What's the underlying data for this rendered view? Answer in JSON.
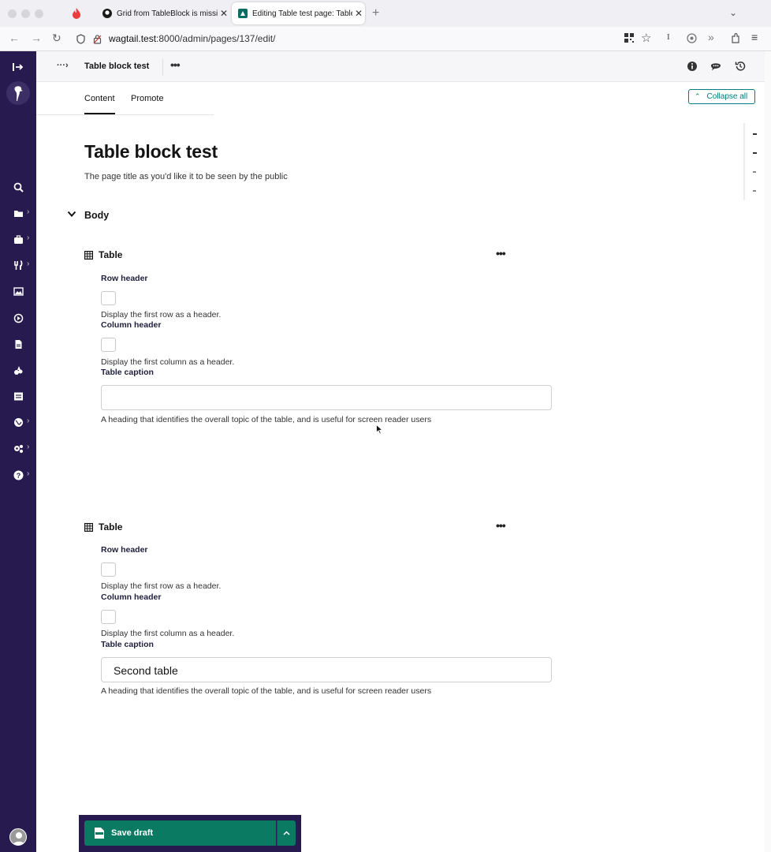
{
  "browser": {
    "tabs": [
      {
        "label": "Grid from TableBlock is missing",
        "active": false
      },
      {
        "label": "Editing Table test page: Table bl",
        "active": true
      }
    ],
    "url_host": "wagtail.test",
    "url_path": ":8000/admin/pages/137/edit/"
  },
  "header": {
    "title": "Table block test"
  },
  "tabs": {
    "content": "Content",
    "promote": "Promote",
    "collapse_all": "Collapse all"
  },
  "page": {
    "title": "Table block test",
    "title_help": "The page title as you'd like it to be seen by the public",
    "section_title": "Body"
  },
  "blocks": [
    {
      "title": "Table",
      "row_header_label": "Row header",
      "row_header_help": "Display the first row as a header.",
      "column_header_label": "Column header",
      "column_header_help": "Display the first column as a header.",
      "caption_label": "Table caption",
      "caption_value": "",
      "caption_help": "A heading that identifies the overall topic of the table, and is useful for screen reader users"
    },
    {
      "title": "Table",
      "row_header_label": "Row header",
      "row_header_help": "Display the first row as a header.",
      "column_header_label": "Column header",
      "column_header_help": "Display the first column as a header.",
      "caption_label": "Table caption",
      "caption_value": "Second table",
      "caption_help": "A heading that identifies the overall topic of the table, and is useful for screen reader users"
    }
  ],
  "footer": {
    "save_label": "Save draft"
  },
  "colors": {
    "sidebar": "#261a4e",
    "primary_action": "#0a7a63",
    "accent": "#007d7e"
  },
  "icons": [
    "sidebar-toggle-icon",
    "wagtail-logo-icon",
    "search-icon",
    "folder-icon",
    "briefcase-icon",
    "utensils-icon",
    "image-icon",
    "media-icon",
    "document-icon",
    "snippet-icon",
    "forms-icon",
    "globe-icon",
    "cogs-icon",
    "help-icon",
    "info-icon",
    "comment-icon",
    "history-icon",
    "table-icon",
    "draft-icon"
  ]
}
